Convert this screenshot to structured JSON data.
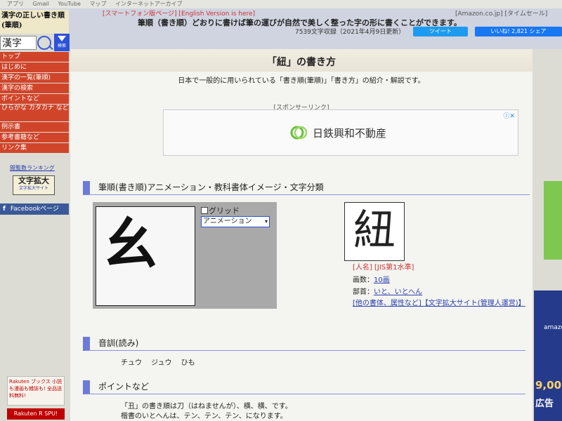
{
  "bookmarks": [
    "アプリ",
    "Gmail",
    "YouTube",
    "マップ",
    "インターネットアーカイブ"
  ],
  "header": {
    "logo_text": "漢字の正しい書き順(筆順)",
    "top_links": "[スマートフォン版ページ] [English Version is here]",
    "tagline": "筆順（書き順）どおりに書けば筆の運びが自然で美しく整った字の形に書くことができます。",
    "subline": "7539文字収録（2021年4月9日更新）",
    "amazon": "[Amazon.co.jp] [タイムセール]",
    "tweet": "ツイート",
    "fb_like": "いいね! 2,821 シェア"
  },
  "sidebar": {
    "search_value": "漢字",
    "search_go": "検索",
    "menu": [
      "トップ",
      "はじめに",
      "漢字の一覧(筆順)",
      "漢字の検索",
      "ポイントなど",
      "ひらがな カタカナ など",
      "例示書",
      "参考書籍など",
      "リンク集"
    ],
    "ranking": "閲覧数ランキング",
    "moji_title": "文字拡大",
    "moji_sub": "文字拡大サイト",
    "facebook": "Facebookページ",
    "rakuten_books": "Rakuten ブックス 小説も漫画も雑誌も! 全品送料無料!",
    "rakuten_spu": "Rakuten R SPU!"
  },
  "main": {
    "title": "「紐」の書き方",
    "description": "日本で一般的に用いられている「書き順(筆順)」「書き方」の紹介・解説です。",
    "sponsor": "[スポンサーリンク]",
    "ad": {
      "text": "日鉄興和不動産",
      "close": "ⓘ✕"
    },
    "section1": "筆順(書き順)アニメーション・教科書体イメージ・文字分類",
    "anim_char": "幺",
    "grid_label": "グリッド",
    "anim_mode": "アニメーション",
    "char": "紐",
    "tags": "[人名] [JIS第1水準]",
    "strokes_label": "画数：",
    "strokes_value": "10画",
    "radical_label": "部首：",
    "radical_value": "いと、いとへん",
    "more": "[他の書体、属性など]【文字拡大サイト(管理人運営)】",
    "section2": "音訓(読み)",
    "readings": "チュウ ジュウ ひも",
    "section3": "ポイントなど",
    "point1": "「丑」の書き順は刀（はねませんが）、横、横、です。",
    "point2": "楷書のいとへんは、テン、テン、テン、になります。"
  },
  "right": {
    "amazon_label": "amazon",
    "price": "9,00",
    "ad_word": "広告"
  },
  "colors": {
    "menu_red": "#d0452a",
    "heading_blue": "#6d7bd8",
    "link": "#2a3fb0"
  }
}
